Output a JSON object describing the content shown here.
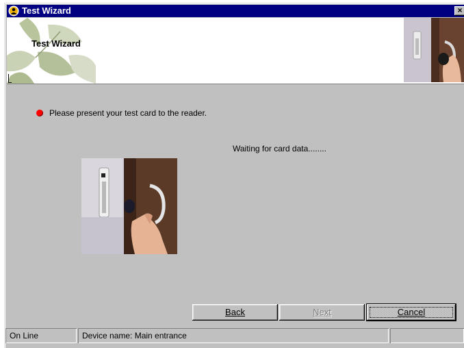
{
  "window": {
    "title": "Test Wizard",
    "close_label": "×"
  },
  "banner": {
    "title": "Test Wizard"
  },
  "content": {
    "prompt": "Please present your test card to the reader.",
    "waiting": "Waiting for card data........",
    "status_dot_color": "#ff0000"
  },
  "buttons": {
    "back": "Back",
    "next": "Next",
    "cancel": "Cancel"
  },
  "statusbar": {
    "connection": "On Line",
    "device": "Device name: Main entrance",
    "extra": ""
  },
  "colors": {
    "titlebar": "#000080",
    "face": "#c0c0c0"
  }
}
